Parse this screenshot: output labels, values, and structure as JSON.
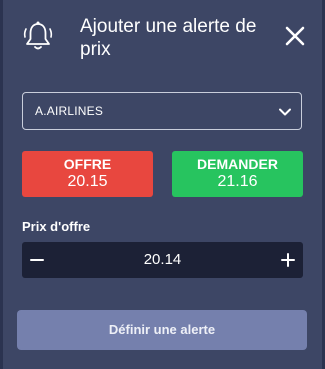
{
  "dialog": {
    "title": "Ajouter une alerte de prix",
    "icon": "bell-icon",
    "close_icon": "close-icon"
  },
  "instrument": {
    "selected": "A.AIRLINES",
    "icon": "chevron-down-icon"
  },
  "prices": {
    "offer_label": "OFFRE",
    "offer_value": "20.15",
    "offer_color": "#e8473f",
    "ask_label": "DEMANDER",
    "ask_value": "21.16",
    "ask_color": "#27c45f"
  },
  "price_field": {
    "label": "Prix d'offre",
    "value": "20.14",
    "decrement_icon": "minus-icon",
    "increment_icon": "plus-icon"
  },
  "submit": {
    "label": "Définir une alerte"
  }
}
